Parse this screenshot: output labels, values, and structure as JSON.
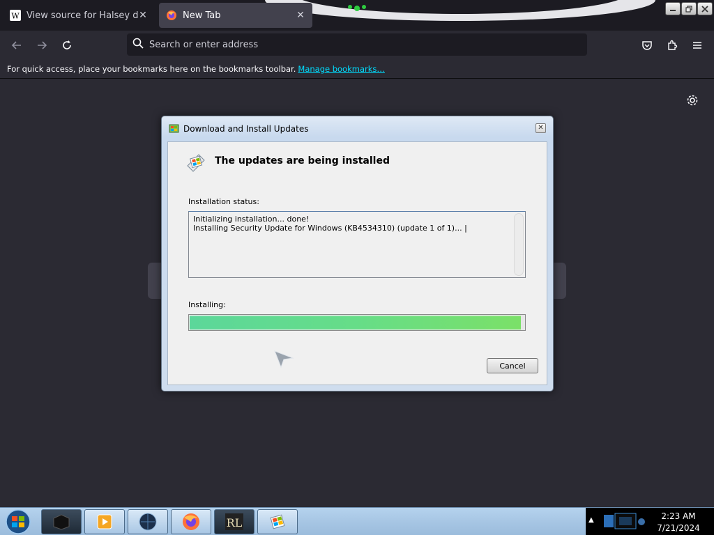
{
  "browser": {
    "tabs": [
      {
        "title": "View source for Halsey discogra",
        "favicon": "wikipedia-icon",
        "active": false
      },
      {
        "title": "New Tab",
        "favicon": "firefox-icon",
        "active": true
      }
    ],
    "tab_close": "✕",
    "window_controls": [
      "minimize",
      "restore",
      "close"
    ],
    "urlbar": {
      "placeholder": "Search or enter address",
      "value": ""
    },
    "bookmarks_bar": {
      "message": "For quick access, place your bookmarks here on the bookmarks toolbar.",
      "link": "Manage bookmarks…"
    }
  },
  "dialog": {
    "title": "Download and Install Updates",
    "heading": "The updates are being installed",
    "status_label": "Installation status:",
    "status_lines": [
      "Initializing installation... done!",
      "Installing Security Update for Windows (KB4534310) (update 1 of 1)... |"
    ],
    "progress_label": "Installing:",
    "progress": 0.99,
    "cancel": "Cancel"
  },
  "taskbar": {
    "items": [
      "terminal-app",
      "media-player",
      "globe-app",
      "firefox",
      "rl-app",
      "windows-update"
    ],
    "time": "2:23 AM",
    "date": "7/21/2024"
  },
  "colors": {
    "accent_link": "#00ddff",
    "progress_green": "#66dd88"
  }
}
